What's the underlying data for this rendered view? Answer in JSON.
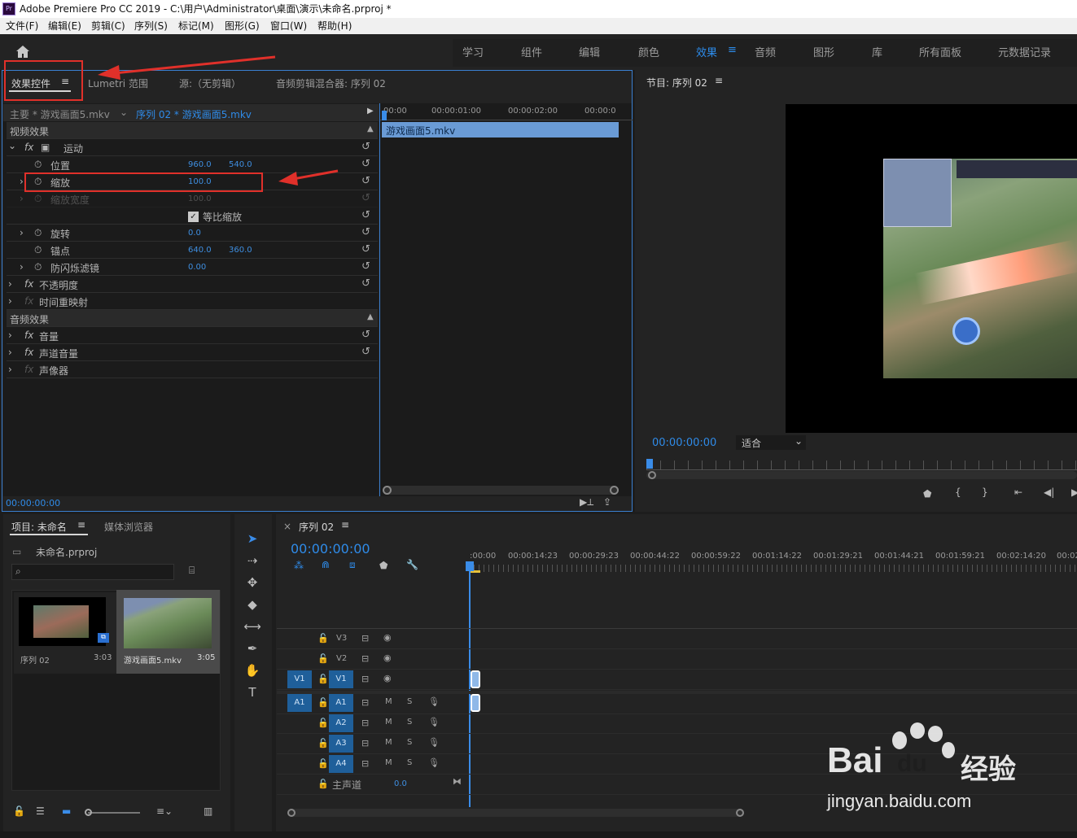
{
  "window": {
    "title": "Adobe Premiere Pro CC 2019 - C:\\用户\\Administrator\\桌面\\演示\\未命名.prproj *",
    "app_icon": "Pr"
  },
  "menu": [
    "文件(F)",
    "编辑(E)",
    "剪辑(C)",
    "序列(S)",
    "标记(M)",
    "图形(G)",
    "窗口(W)",
    "帮助(H)"
  ],
  "workspaces": [
    "学习",
    "组件",
    "编辑",
    "颜色",
    "效果",
    "音频",
    "图形",
    "库",
    "所有面板",
    "元数据记录"
  ],
  "active_workspace": "效果",
  "effect_panel": {
    "tabs": [
      "效果控件",
      "Lumetri 范围",
      "源:（无剪辑）",
      "音频剪辑混合器: 序列 02"
    ],
    "master": "主要 * 游戏画面5.mkv",
    "sequence_clip": "序列 02 * 游戏画面5.mkv",
    "ruler": [
      "00:00",
      "00:00:01:00",
      "00:00:02:00",
      "00:00:0"
    ],
    "clip_bar": "游戏画面5.mkv",
    "video_section": "视频效果",
    "motion": "运动",
    "position_label": "位置",
    "position_x": "960.0",
    "position_y": "540.0",
    "scale_label": "缩放",
    "scale_value": "100.0",
    "scale_width_label": "缩放宽度",
    "scale_width_value": "100.0",
    "uniform_label": "等比缩放",
    "rotation_label": "旋转",
    "rotation_value": "0.0",
    "anchor_label": "锚点",
    "anchor_x": "640.0",
    "anchor_y": "360.0",
    "flicker_label": "防闪烁滤镜",
    "flicker_value": "0.00",
    "opacity": "不透明度",
    "time_remap": "时间重映射",
    "audio_section": "音频效果",
    "volume": "音量",
    "channel_volume": "声道音量",
    "panner": "声像器",
    "timecode": "00:00:00:00"
  },
  "program": {
    "title": "节目: 序列 02",
    "timecode": "00:00:00:00",
    "fit": "适合"
  },
  "project": {
    "tabs": [
      "项目: 未命名",
      "媒体浏览器"
    ],
    "file": "未命名.prproj",
    "items": [
      {
        "name": "序列 02",
        "dur": "3:03"
      },
      {
        "name": "游戏画面5.mkv",
        "dur": "3:05"
      }
    ]
  },
  "timeline": {
    "title": "序列 02",
    "timecode": "00:00:00:00",
    "ruler": [
      ":00:00",
      "00:00:14:23",
      "00:00:29:23",
      "00:00:44:22",
      "00:00:59:22",
      "00:01:14:22",
      "00:01:29:21",
      "00:01:44:21",
      "00:01:59:21",
      "00:02:14:20",
      "00:02"
    ],
    "tracks": [
      "V3",
      "V2",
      "V1",
      "A1",
      "A2",
      "A3",
      "A4"
    ],
    "src_v": "V1",
    "src_a": "A1",
    "master": "主声道",
    "master_value": "0.0",
    "m": "M",
    "s": "S"
  },
  "watermark": {
    "brand": "Bai",
    "brand2": "du",
    "cn": "经验",
    "url": "jingyan.baidu.com"
  },
  "colors": {
    "accent": "#2d8ceb",
    "annotation": "#e0302a"
  }
}
